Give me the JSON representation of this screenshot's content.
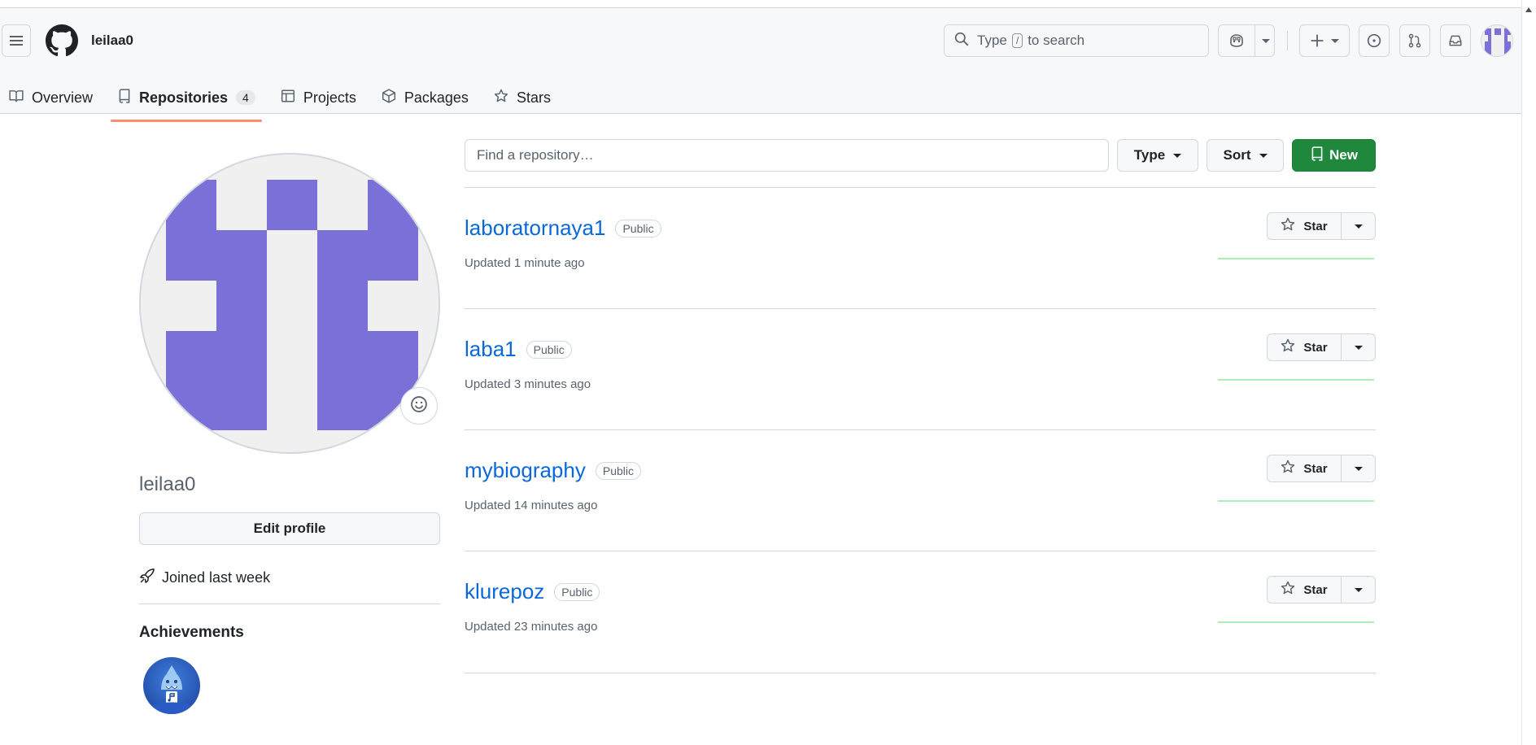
{
  "header": {
    "username": "leilaa0",
    "search_prefix": "Type",
    "search_key": "/",
    "search_suffix": "to search"
  },
  "tabs": [
    {
      "label": "Overview"
    },
    {
      "label": "Repositories",
      "count": "4"
    },
    {
      "label": "Projects"
    },
    {
      "label": "Packages"
    },
    {
      "label": "Stars"
    }
  ],
  "profile": {
    "name": "leilaa0",
    "edit_label": "Edit profile",
    "joined": "Joined last week",
    "achievements_title": "Achievements"
  },
  "toolbar": {
    "find_placeholder": "Find a repository…",
    "type_label": "Type",
    "sort_label": "Sort",
    "new_label": "New"
  },
  "repos": [
    {
      "name": "laboratornaya1",
      "visibility": "Public",
      "updated": "Updated 1 minute ago",
      "star_label": "Star"
    },
    {
      "name": "laba1",
      "visibility": "Public",
      "updated": "Updated 3 minutes ago",
      "star_label": "Star"
    },
    {
      "name": "mybiography",
      "visibility": "Public",
      "updated": "Updated 14 minutes ago",
      "star_label": "Star"
    },
    {
      "name": "klurepoz",
      "visibility": "Public",
      "updated": "Updated 23 minutes ago",
      "star_label": "Star"
    }
  ],
  "colors": {
    "identicon": "#7b6fd8",
    "primary_button": "#1f883d",
    "link": "#0969da",
    "active_tab_underline": "#fd8c73"
  },
  "icons": [
    "hamburger-icon",
    "github-logo-icon",
    "search-icon",
    "copilot-icon",
    "plus-icon",
    "issues-icon",
    "pull-request-icon",
    "inbox-icon",
    "book-icon",
    "repo-icon",
    "table-icon",
    "package-icon",
    "star-icon",
    "smiley-icon",
    "rocket-icon"
  ]
}
